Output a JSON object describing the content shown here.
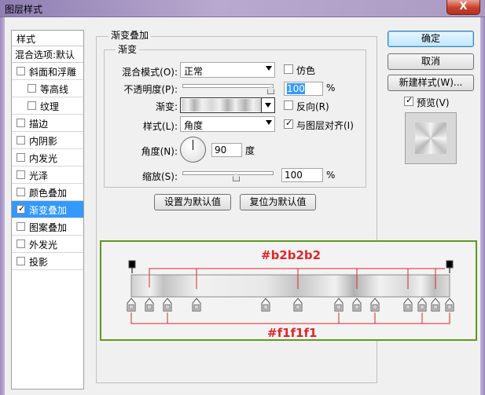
{
  "window": {
    "title": "图层样式",
    "close_label": "X"
  },
  "style_list": {
    "header": "样式",
    "blend_options": "混合选项:默认",
    "items": [
      {
        "label": "斜面和浮雕",
        "checked": false,
        "sub": false,
        "selected": false
      },
      {
        "label": "等高线",
        "checked": false,
        "sub": true,
        "selected": false
      },
      {
        "label": "纹理",
        "checked": false,
        "sub": true,
        "selected": false
      },
      {
        "label": "描边",
        "checked": false,
        "sub": false,
        "selected": false
      },
      {
        "label": "内阴影",
        "checked": false,
        "sub": false,
        "selected": false
      },
      {
        "label": "内发光",
        "checked": false,
        "sub": false,
        "selected": false
      },
      {
        "label": "光泽",
        "checked": false,
        "sub": false,
        "selected": false
      },
      {
        "label": "颜色叠加",
        "checked": false,
        "sub": false,
        "selected": false
      },
      {
        "label": "渐变叠加",
        "checked": true,
        "sub": false,
        "selected": true
      },
      {
        "label": "图案叠加",
        "checked": false,
        "sub": false,
        "selected": false
      },
      {
        "label": "外发光",
        "checked": false,
        "sub": false,
        "selected": false
      },
      {
        "label": "投影",
        "checked": false,
        "sub": false,
        "selected": false
      }
    ]
  },
  "panel": {
    "group_title": "渐变叠加",
    "subgroup_title": "渐变",
    "blend_mode_label": "混合模式(O):",
    "blend_mode_value": "正常",
    "dither_label": "仿色",
    "opacity_label": "不透明度(P):",
    "opacity_value": "100",
    "opacity_level": 1.0,
    "percent": "%",
    "gradient_label": "渐变:",
    "reverse_label": "反向(R)",
    "style_label": "样式(L):",
    "style_value": "角度",
    "align_label": "与图层对齐(I)",
    "angle_label": "角度(N):",
    "angle_value": "90",
    "degree": "度",
    "scale_label": "缩放(S):",
    "scale_value": "100",
    "scale_level": 0.5,
    "set_default": "设置为默认值",
    "reset_default": "复位为默认值"
  },
  "buttons": {
    "ok": "确定",
    "cancel": "取消",
    "new_style": "新建样式(W)...",
    "preview": "预览(V)"
  },
  "annotation": {
    "top_color": "#b2b2b2",
    "bottom_color": "#f1f1f1",
    "colors": {
      "accent_red": "#e0262a",
      "border_green": "#5c9a1c"
    }
  }
}
